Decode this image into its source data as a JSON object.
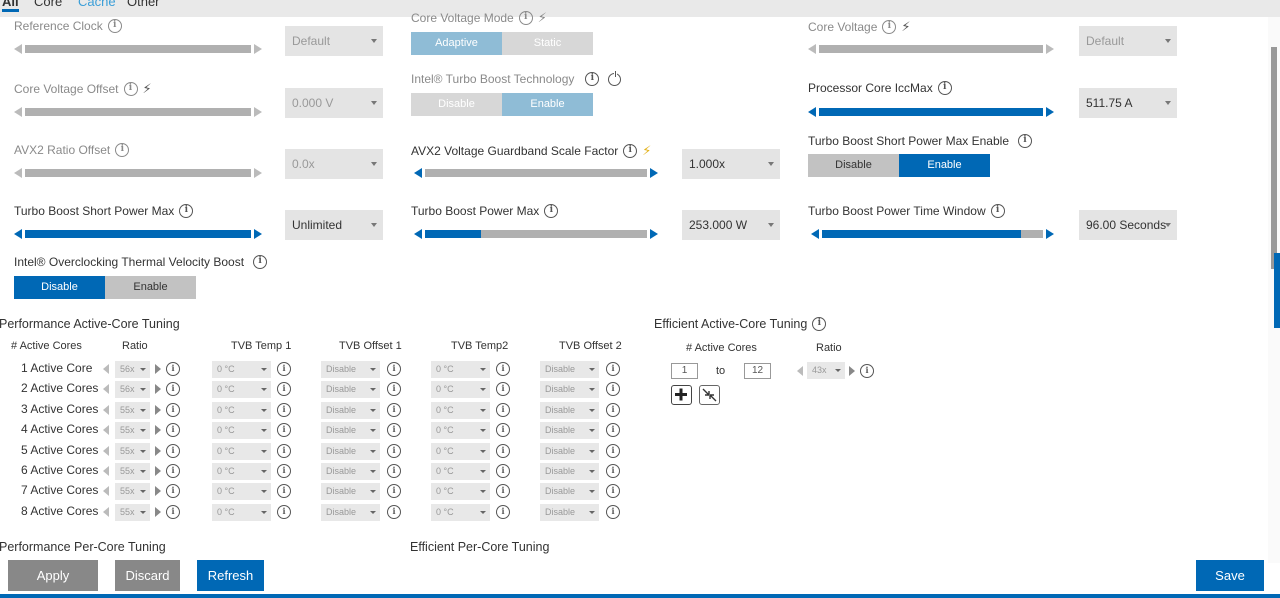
{
  "tabs": [
    {
      "label": "All"
    },
    {
      "label": "Core"
    },
    {
      "label": "Cache"
    },
    {
      "label": "Other"
    }
  ],
  "settings": {
    "reference_clock": {
      "label": "Reference Clock",
      "value": "Default"
    },
    "core_voltage_mode": {
      "label": "Core Voltage Mode",
      "options": [
        "Adaptive",
        "Static"
      ],
      "selected": "Adaptive"
    },
    "core_voltage": {
      "label": "Core Voltage",
      "value": "Default"
    },
    "core_voltage_offset": {
      "label": "Core Voltage Offset",
      "value": "0.000 V"
    },
    "turbo_boost_tech": {
      "label": "Intel® Turbo Boost Technology",
      "options": [
        "Disable",
        "Enable"
      ],
      "selected": "Enable"
    },
    "processor_core_iccmax": {
      "label": "Processor Core IccMax",
      "value": "511.75 A",
      "level": 1.0
    },
    "avx2_ratio_offset": {
      "label": "AVX2 Ratio Offset",
      "value": "0.0x"
    },
    "avx2_voltage_guardband": {
      "label": "AVX2 Voltage Guardband Scale Factor",
      "value": "1.000x"
    },
    "turbo_short_power_max_enable": {
      "label": "Turbo Boost Short Power Max Enable",
      "options": [
        "Disable",
        "Enable"
      ],
      "selected": "Enable"
    },
    "turbo_short_power_max": {
      "label": "Turbo Boost Short Power Max",
      "value": "Unlimited",
      "level": 1.0
    },
    "turbo_power_max": {
      "label": "Turbo Boost Power Max",
      "value": "253.000 W",
      "level": 0.25
    },
    "turbo_power_time_window": {
      "label": "Turbo Boost Power Time Window",
      "value": "96.00 Seconds",
      "level": 0.9
    },
    "otvb": {
      "label": "Intel® Overclocking Thermal Velocity Boost",
      "options": [
        "Disable",
        "Enable"
      ],
      "selected": "Disable"
    }
  },
  "perf_active_core": {
    "title": "Performance Active-Core Tuning",
    "columns": [
      "# Active Cores",
      "Ratio",
      "TVB Temp 1",
      "TVB Offset 1",
      "TVB Temp2",
      "TVB Offset 2"
    ],
    "rows": [
      {
        "label": "1 Active Core",
        "ratio": "56x",
        "temp1": "0 °C",
        "offset1": "Disable",
        "temp2": "0 °C",
        "offset2": "Disable"
      },
      {
        "label": "2 Active Cores",
        "ratio": "56x",
        "temp1": "0 °C",
        "offset1": "Disable",
        "temp2": "0 °C",
        "offset2": "Disable"
      },
      {
        "label": "3 Active Cores",
        "ratio": "55x",
        "temp1": "0 °C",
        "offset1": "Disable",
        "temp2": "0 °C",
        "offset2": "Disable"
      },
      {
        "label": "4 Active Cores",
        "ratio": "55x",
        "temp1": "0 °C",
        "offset1": "Disable",
        "temp2": "0 °C",
        "offset2": "Disable"
      },
      {
        "label": "5 Active Cores",
        "ratio": "55x",
        "temp1": "0 °C",
        "offset1": "Disable",
        "temp2": "0 °C",
        "offset2": "Disable"
      },
      {
        "label": "6 Active Cores",
        "ratio": "55x",
        "temp1": "0 °C",
        "offset1": "Disable",
        "temp2": "0 °C",
        "offset2": "Disable"
      },
      {
        "label": "7 Active Cores",
        "ratio": "55x",
        "temp1": "0 °C",
        "offset1": "Disable",
        "temp2": "0 °C",
        "offset2": "Disable"
      },
      {
        "label": "8 Active Cores",
        "ratio": "55x",
        "temp1": "0 °C",
        "offset1": "Disable",
        "temp2": "0 °C",
        "offset2": "Disable"
      }
    ]
  },
  "eff_active_core": {
    "title": "Efficient Active-Core Tuning",
    "col_cores": "# Active Cores",
    "col_ratio": "Ratio",
    "from": "1",
    "to_label": "to",
    "to": "12",
    "ratio": "43x"
  },
  "perf_per_core": {
    "title": "Performance Per-Core Tuning"
  },
  "eff_per_core": {
    "title": "Efficient Per-Core Tuning"
  },
  "actions": {
    "apply": "Apply",
    "discard": "Discard",
    "refresh": "Refresh",
    "save": "Save"
  },
  "colors": {
    "accent": "#0068b5",
    "muted_accent": "#8fbcd6",
    "gray_button": "#888888",
    "warning_icon": "#e3b21b"
  }
}
